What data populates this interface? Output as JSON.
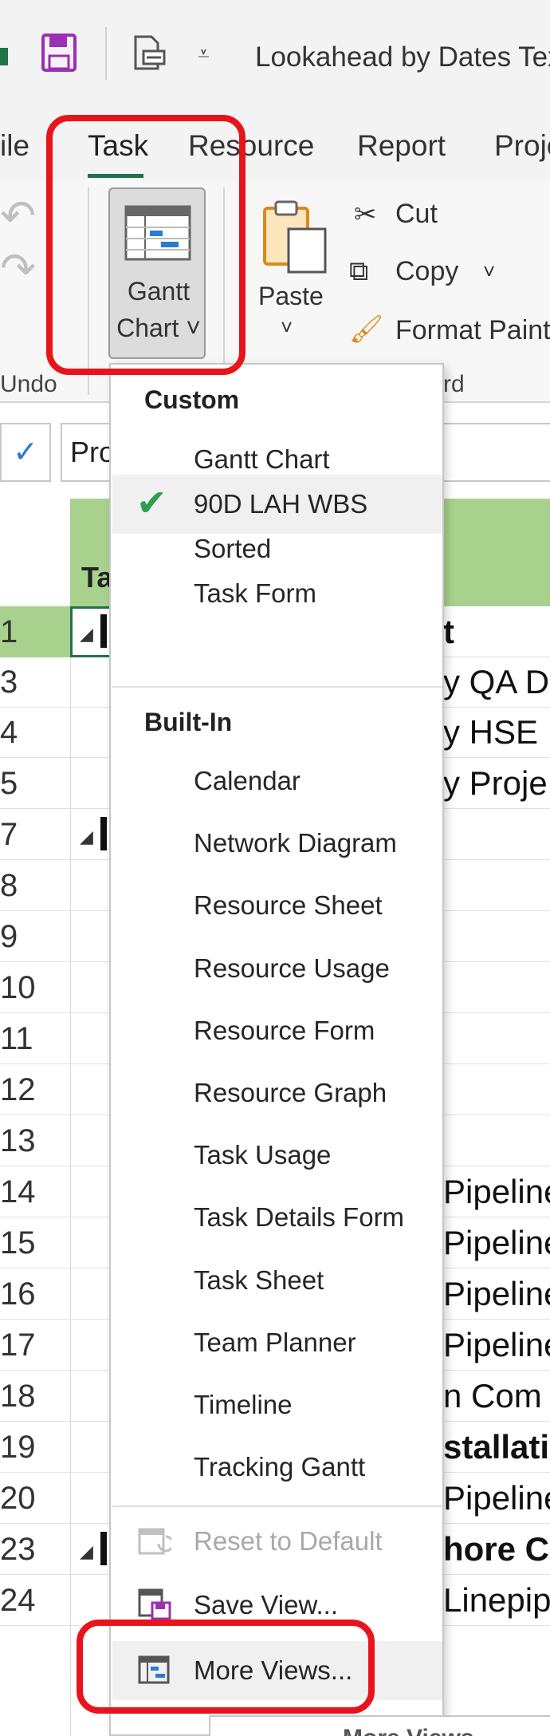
{
  "titlebar": {
    "title": "Lookahead by Dates Text"
  },
  "tabs": [
    "ile",
    "Task",
    "Resource",
    "Report",
    "Proje"
  ],
  "ribbon": {
    "undo_group": "Undo",
    "gantt_button": {
      "line1": "Gantt",
      "line2": "Chart ˅"
    },
    "paste": "Paste",
    "cut": "Cut",
    "copy": "Copy",
    "format_painter": "Format Painter",
    "clipboard_group": "rd"
  },
  "formula_bar": {
    "value": "Pro"
  },
  "grid": {
    "header": "Ta",
    "rows": [
      {
        "id": "1",
        "text": "t",
        "bold": true,
        "summary": true,
        "selected": true
      },
      {
        "id": "3",
        "text": "y QA D"
      },
      {
        "id": "4",
        "text": "y HSE"
      },
      {
        "id": "5",
        "text": "y Proje"
      },
      {
        "id": "7",
        "text": "",
        "summary": true
      },
      {
        "id": "8",
        "text": ""
      },
      {
        "id": "9",
        "text": ""
      },
      {
        "id": "10",
        "text": ""
      },
      {
        "id": "11",
        "text": ""
      },
      {
        "id": "12",
        "text": ""
      },
      {
        "id": "13",
        "text": ""
      },
      {
        "id": "14",
        "text": "Pipeline"
      },
      {
        "id": "15",
        "text": "Pipeline"
      },
      {
        "id": "16",
        "text": "Pipeline"
      },
      {
        "id": "17",
        "text": "Pipeline"
      },
      {
        "id": "18",
        "text": "n Com"
      },
      {
        "id": "19",
        "text": "stallatio",
        "bold": true
      },
      {
        "id": "20",
        "text": "Pipeline"
      },
      {
        "id": "23",
        "text": "hore C",
        "bold": true,
        "summary": true
      },
      {
        "id": "24",
        "text": "Linepip"
      }
    ]
  },
  "menu": {
    "custom_header": "Custom",
    "custom_items": [
      "Gantt Chart",
      "90D LAH WBS",
      "Sorted",
      "Task Form"
    ],
    "checked_item": "90D LAH WBS",
    "builtin_header": "Built-In",
    "builtin_items": [
      "Calendar",
      "Network Diagram",
      "Resource Sheet",
      "Resource Usage",
      "Resource Form",
      "Resource Graph",
      "Task Usage",
      "Task Details Form",
      "Task Sheet",
      "Team Planner",
      "Timeline",
      "Tracking Gantt"
    ],
    "reset": "Reset to Default",
    "save_view": "Save View...",
    "more_views": "More Views...",
    "tooltip": "More Views"
  },
  "colors": {
    "accent_green": "#217346",
    "highlight_red": "#e8141c",
    "header_green": "#a9d18e",
    "check_green": "#2e9e4f"
  }
}
